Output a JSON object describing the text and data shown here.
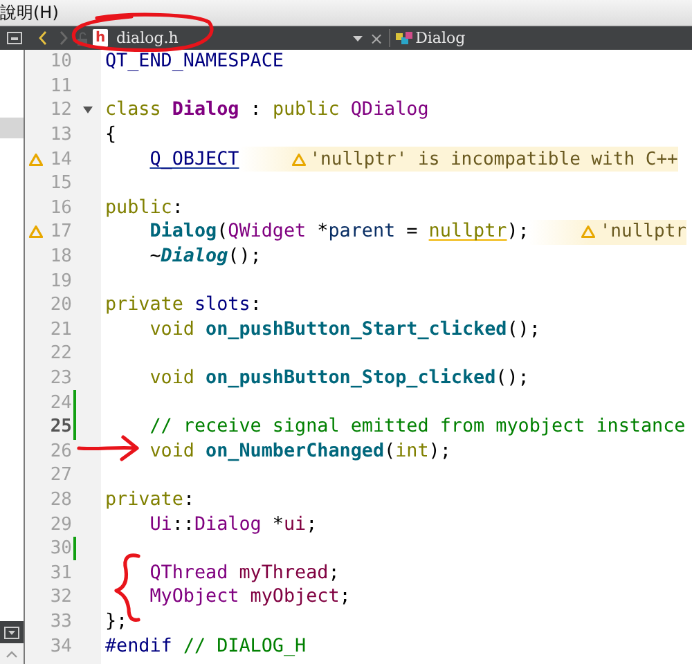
{
  "menu": {
    "items": [
      "說明(H)"
    ]
  },
  "toolbar": {
    "back_disabled": false,
    "forward_disabled": true,
    "file_icon": "h",
    "file": "dialog.h",
    "close": "×",
    "symbol": "Dialog"
  },
  "sidebar": {
    "has_selection": true
  },
  "editor": {
    "lines": [
      {
        "number": "10",
        "indented": false,
        "tokens": [
          {
            "text": "QT_END_NAMESPACE",
            "kind": "macro"
          }
        ]
      },
      {
        "number": "11"
      },
      {
        "number": "12",
        "fold": true,
        "indented": false,
        "tokens": [
          {
            "text": "class ",
            "kind": "keyword"
          },
          {
            "text": "Dialog",
            "kind": "class-decl"
          },
          {
            "text": " : ",
            "kind": "plain"
          },
          {
            "text": "public ",
            "kind": "keyword"
          },
          {
            "text": "QDialog",
            "kind": "type"
          }
        ]
      },
      {
        "number": "13",
        "indented": false,
        "tokens": [
          {
            "text": "{",
            "kind": "plain"
          }
        ]
      },
      {
        "number": "14",
        "warning": true,
        "indented": true,
        "tokens": [
          {
            "text": "Q_OBJECT",
            "kind": "macro",
            "underlined": true
          }
        ],
        "annotation": "'nullptr' is incompatible with C++"
      },
      {
        "number": "15"
      },
      {
        "number": "16",
        "indented": false,
        "tokens": [
          {
            "text": "public",
            "kind": "keyword"
          },
          {
            "text": ":",
            "kind": "plain"
          }
        ]
      },
      {
        "number": "17",
        "warning": true,
        "indented": true,
        "tokens": [
          {
            "text": "Dialog",
            "kind": "function"
          },
          {
            "text": "(",
            "kind": "plain"
          },
          {
            "text": "QWidget",
            "kind": "type"
          },
          {
            "text": " *",
            "kind": "plain"
          },
          {
            "text": "parent",
            "kind": "param"
          },
          {
            "text": " = ",
            "kind": "plain"
          },
          {
            "text": "nullptr",
            "kind": "keyword",
            "warning": true
          },
          {
            "text": ");",
            "kind": "plain"
          }
        ],
        "annotation": "'nullptr"
      },
      {
        "number": "18",
        "indented": true,
        "tokens": [
          {
            "text": "~",
            "kind": "plain"
          },
          {
            "text": "Dialog",
            "kind": "function-italic"
          },
          {
            "text": "();",
            "kind": "plain"
          }
        ]
      },
      {
        "number": "19"
      },
      {
        "number": "20",
        "indented": false,
        "tokens": [
          {
            "text": "private ",
            "kind": "keyword"
          },
          {
            "text": "slots",
            "kind": "macro"
          },
          {
            "text": ":",
            "kind": "plain"
          }
        ]
      },
      {
        "number": "21",
        "indented": true,
        "tokens": [
          {
            "text": "void ",
            "kind": "keyword"
          },
          {
            "text": "on_pushButton_Start_clicked",
            "kind": "function"
          },
          {
            "text": "();",
            "kind": "plain"
          }
        ]
      },
      {
        "number": "22"
      },
      {
        "number": "23",
        "indented": true,
        "tokens": [
          {
            "text": "void ",
            "kind": "keyword"
          },
          {
            "text": "on_pushButton_Stop_clicked",
            "kind": "function"
          },
          {
            "text": "();",
            "kind": "plain"
          }
        ]
      },
      {
        "number": "24",
        "changed": true
      },
      {
        "number": "25",
        "changed": true,
        "current": true,
        "indented": true,
        "tokens": [
          {
            "text": "// receive signal emitted from myobject instance",
            "kind": "comment"
          }
        ]
      },
      {
        "number": "26",
        "indented": true,
        "tokens": [
          {
            "text": "void ",
            "kind": "keyword"
          },
          {
            "text": "on_NumberChanged",
            "kind": "function"
          },
          {
            "text": "(",
            "kind": "plain"
          },
          {
            "text": "int",
            "kind": "keyword"
          },
          {
            "text": ");",
            "kind": "plain"
          }
        ]
      },
      {
        "number": "27"
      },
      {
        "number": "28",
        "indented": false,
        "tokens": [
          {
            "text": "private",
            "kind": "keyword"
          },
          {
            "text": ":",
            "kind": "plain"
          }
        ]
      },
      {
        "number": "29",
        "indented": true,
        "tokens": [
          {
            "text": "Ui",
            "kind": "type"
          },
          {
            "text": "::",
            "kind": "plain"
          },
          {
            "text": "Dialog",
            "kind": "type"
          },
          {
            "text": " *",
            "kind": "plain"
          },
          {
            "text": "ui",
            "kind": "field"
          },
          {
            "text": ";",
            "kind": "plain"
          }
        ]
      },
      {
        "number": "30",
        "changed": true
      },
      {
        "number": "31",
        "indented": true,
        "tokens": [
          {
            "text": "QThread ",
            "kind": "type"
          },
          {
            "text": "myThread",
            "kind": "field"
          },
          {
            "text": ";",
            "kind": "plain"
          }
        ]
      },
      {
        "number": "32",
        "indented": true,
        "tokens": [
          {
            "text": "MyObject ",
            "kind": "type"
          },
          {
            "text": "myObject",
            "kind": "field"
          },
          {
            "text": ";",
            "kind": "plain"
          }
        ]
      },
      {
        "number": "33",
        "indented": false,
        "tokens": [
          {
            "text": "};",
            "kind": "plain"
          }
        ]
      },
      {
        "number": "34",
        "indented": false,
        "tokens": [
          {
            "text": "#endif ",
            "kind": "preprocessor"
          },
          {
            "text": "// DIALOG_H",
            "kind": "comment"
          }
        ]
      }
    ]
  },
  "marks": [
    {
      "kind": "circle"
    },
    {
      "kind": "arrow"
    },
    {
      "kind": "brace"
    }
  ]
}
